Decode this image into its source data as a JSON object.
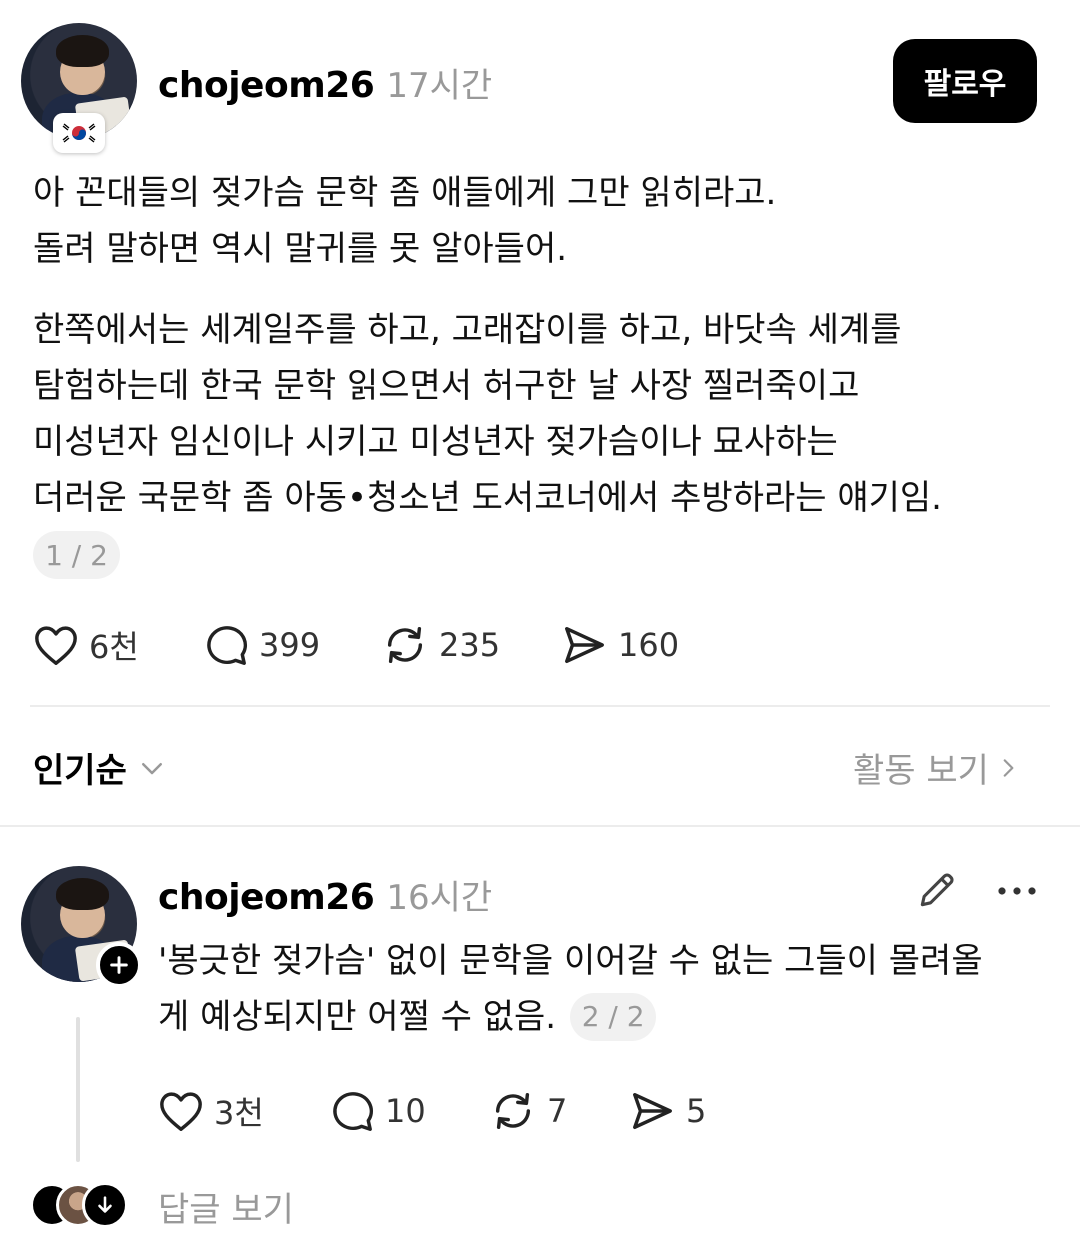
{
  "post": {
    "username": "chojeom26",
    "time": "17시간",
    "follow_label": "팔로우",
    "paragraph1": [
      "아 꼰대들의 젖가슴 문학 좀 애들에게 그만 읽히라고.",
      "돌려 말하면 역시 말귀를 못 알아들어."
    ],
    "paragraph2": [
      "한쪽에서는 세계일주를 하고, 고래잡이를 하고, 바닷속 세계를",
      "탐험하는데 한국 문학 읽으면서 허구한 날 사장 찔러죽이고",
      "미성년자 임신이나 시키고 미성년자 젖가슴이나 묘사하는",
      "더러운 국문학 좀 아동•청소년 도서코너에서 추방하라는 얘기임."
    ],
    "page_indicator": "1 / 2",
    "likes": "6천",
    "comments": "399",
    "reposts": "235",
    "shares": "160"
  },
  "sort": {
    "label": "인기순",
    "activity_label": "활동 보기"
  },
  "reply": {
    "username": "chojeom26",
    "time": "16시간",
    "lines": [
      "'봉긋한 젖가슴' 없이 문학을 이어갈 수 없는 그들이 몰려올",
      "게 예상되지만 어쩔 수 없음."
    ],
    "page_indicator": "2 / 2",
    "likes": "3천",
    "comments": "10",
    "reposts": "7",
    "shares": "5",
    "view_replies_label": "답글 보기"
  },
  "colors": {
    "accent": "#000000",
    "muted": "#999999",
    "divider": "#ececec"
  },
  "icons": [
    "heart-icon",
    "comment-icon",
    "repost-icon",
    "share-icon",
    "pencil-icon",
    "more-icon",
    "chevron-down-icon",
    "chevron-right-icon",
    "plus-icon",
    "arrow-down-icon",
    "korea-flag-icon"
  ]
}
